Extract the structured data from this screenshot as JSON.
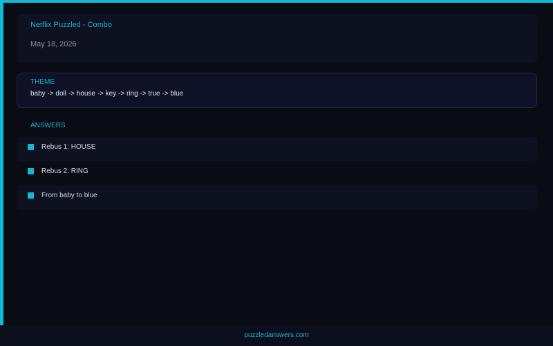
{
  "header": {
    "title": "Netflix Puzzled - Combo",
    "date": "May 18, 2026"
  },
  "theme": {
    "label": "THEME",
    "text": "baby -> doll -> house -> key -> ring -> true -> blue"
  },
  "answers": {
    "label": "ANSWERS",
    "items": [
      {
        "text": "Rebus 1: HOUSE",
        "icon": "square-bullet-icon"
      },
      {
        "text": "Rebus 2: RING",
        "icon": "square-bullet-icon"
      },
      {
        "text": "From baby to blue",
        "icon": "square-bullet-icon"
      }
    ]
  },
  "footer": {
    "link": "puzzledanswers.com"
  },
  "colors": {
    "accent": "#13b8d2",
    "background": "#090b15",
    "card": "#0e111f"
  }
}
